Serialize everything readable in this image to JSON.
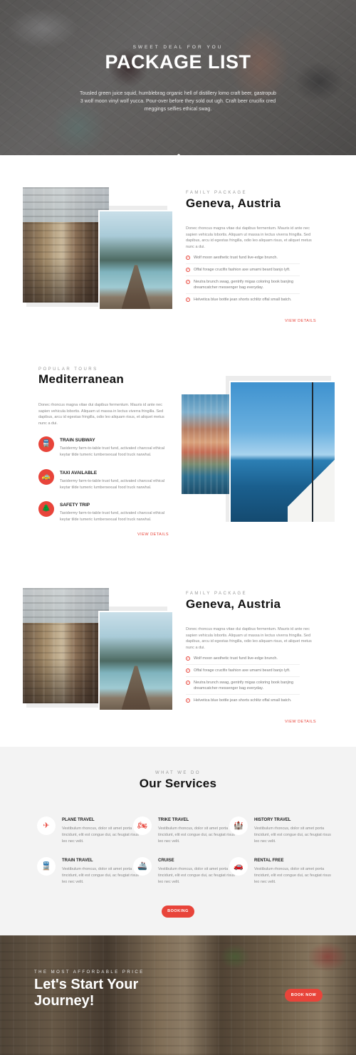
{
  "hero": {
    "kicker": "SWEET DEAL FOR YOU",
    "title": "PACKAGE LIST",
    "text": "Tousled green juice squid, humblebrag organic hell of distillery lomo craft beer, gastropub 3 wolf moon vinyl wolf yucca. Pour-over before they sold out ugh. Craft beer crucifix cred meggings selfies ethical swag."
  },
  "package1": {
    "kicker": "FAMILY PACKAGE",
    "title": "Geneva, Austria",
    "description": "Donec rhoncus magna vitae dui dapibus fermentum. Mauris id ante nec sapien vehicula lobortis. Aliquam ut massa in lectus viverra fringilla. Sed dapibus, arcu id egestas fringilla, odio leo aliquam risus, et aliquet metus nunc a dui.",
    "items": [
      "Wolf moon aesthetic trust fund live-edge brunch.",
      "Offal forage crucifix fashion axe umami beard banjo lyft.",
      "Neutra brunch swag, gentrify migas coloring book banjing dreamcatcher messenger bag everyday.",
      "Helvetica blue bottle jean shorts schlitz offal small batch."
    ],
    "link": "VIEW DETAILS"
  },
  "mediterranean": {
    "kicker": "POPULAR TOURS",
    "title": "Mediterranean",
    "description": "Donec rhoncus magna vitae dui dapibus fermentum. Mauris id ante nec sapien vehicula lobortis. Aliquam ut massa in lectus viverra fringilla. Sed dapibus, arcu id egestas fringilla, odio leo aliquam risus, et aliquet metus nunc a dui.",
    "features": [
      {
        "title": "TRAIN SUBWAY",
        "desc": "Taxidermy farm-to-table trust fund, activated charcoal ethical keytar tilde tumeric lumbersexual food truck narwhal.",
        "icon": "train-icon"
      },
      {
        "title": "TAXI AVAILABLE",
        "desc": "Taxidermy farm-to-table trust fund, activated charcoal ethical keytar tilde tumeric lumbersexual food truck narwhal.",
        "icon": "taxi-icon"
      },
      {
        "title": "SAFETY TRIP",
        "desc": "Taxidermy farm-to-table trust fund, activated charcoal ethical keytar tilde tumeric lumbersexual food truck narwhal.",
        "icon": "tree-icon"
      }
    ],
    "link": "VIEW DETAILS"
  },
  "package2": {
    "kicker": "FAMILY PACKAGE",
    "title": "Geneva, Austria",
    "description": "Donec rhoncus magna vitae dui dapibus fermentum. Mauris id ante nec sapien vehicula lobortis. Aliquam ut massa in lectus viverra fringilla. Sed dapibus, arcu id egestas fringilla, odio leo aliquam risus, et aliquet metus nunc a dui.",
    "items": [
      "Wolf moon aesthetic trust fund live-edge brunch.",
      "Offal forage crucifix fashion axe umami beard banjo lyft.",
      "Neutra brunch swag, gentrify migas coloring book banjing dreamcatcher messenger bag everyday.",
      "Helvetica blue bottle jean shorts schlitz offal small batch."
    ],
    "link": "VIEW DETAILS"
  },
  "services": {
    "kicker": "WHAT WE DO",
    "title": "Our Services",
    "items": [
      {
        "title": "PLANE TRAVEL",
        "desc": "Vestibulum rhoncus, dolor sit amet porta tincidunt, elit est congue dui, ac feugiat risus leo nec velit.",
        "icon": "plane-icon"
      },
      {
        "title": "TRIKE TRAVEL",
        "desc": "Vestibulum rhoncus, dolor sit amet porta tincidunt, elit est congue dui, ac feugiat risus leo nec velit.",
        "icon": "motorbike-icon"
      },
      {
        "title": "HISTORY TRAVEL",
        "desc": "Vestibulum rhoncus, dolor sit amet porta tincidunt, elit est congue dui, ac feugiat risus leo nec velit.",
        "icon": "castle-icon"
      },
      {
        "title": "TRAIN TRAVEL",
        "desc": "Vestibulum rhoncus, dolor sit amet porta tincidunt, elit est congue dui, ac feugiat risus leo nec velit.",
        "icon": "train-icon"
      },
      {
        "title": "CRUISE",
        "desc": "Vestibulum rhoncus, dolor sit amet porta tincidunt, elit est congue dui, ac feugiat risus leo nec velit.",
        "icon": "ship-icon"
      },
      {
        "title": "RENTAL FREE",
        "desc": "Vestibulum rhoncus, dolor sit amet porta tincidunt, elit est congue dui, ac feugiat risus leo nec velit.",
        "icon": "car-icon"
      }
    ],
    "button": "BOOKING"
  },
  "cta": {
    "kicker": "THE MOST AFFORDABLE PRICE",
    "title": "Let's Start Your Journey!",
    "button": "BOOK NOW"
  },
  "colors": {
    "accent": "#e8443a",
    "heading": "#111111",
    "services_bg": "#f3f3f3"
  }
}
